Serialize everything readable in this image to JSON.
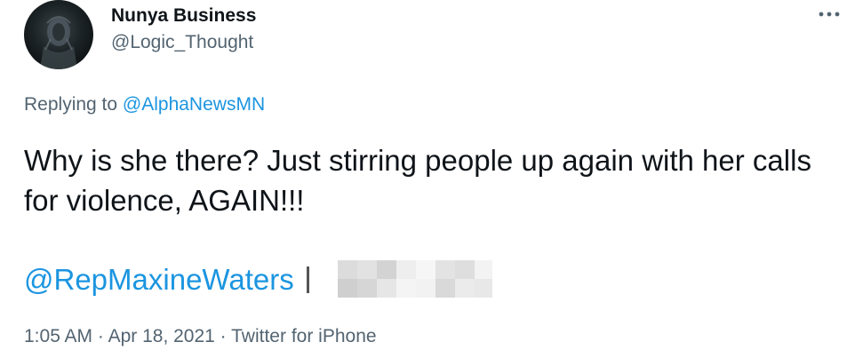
{
  "author": {
    "display_name": "Nunya Business",
    "handle": "@Logic_Thought",
    "avatar_icon": "avatar-image"
  },
  "more_icon": "more-horizontal-icon",
  "reply": {
    "prefix": "Replying to ",
    "mention": "@AlphaNewsMN"
  },
  "text": "Why is she there? Just stirring people up again with her calls for violence, AGAIN!!!",
  "mention_link": "@RepMaxineWaters",
  "meta": {
    "time": "1:05 AM",
    "separator": " · ",
    "date": "Apr 18, 2021",
    "source": "Twitter for iPhone"
  },
  "colors": {
    "link": "#1b95e0",
    "secondary_text": "#536471",
    "primary_text": "#0f1419"
  }
}
